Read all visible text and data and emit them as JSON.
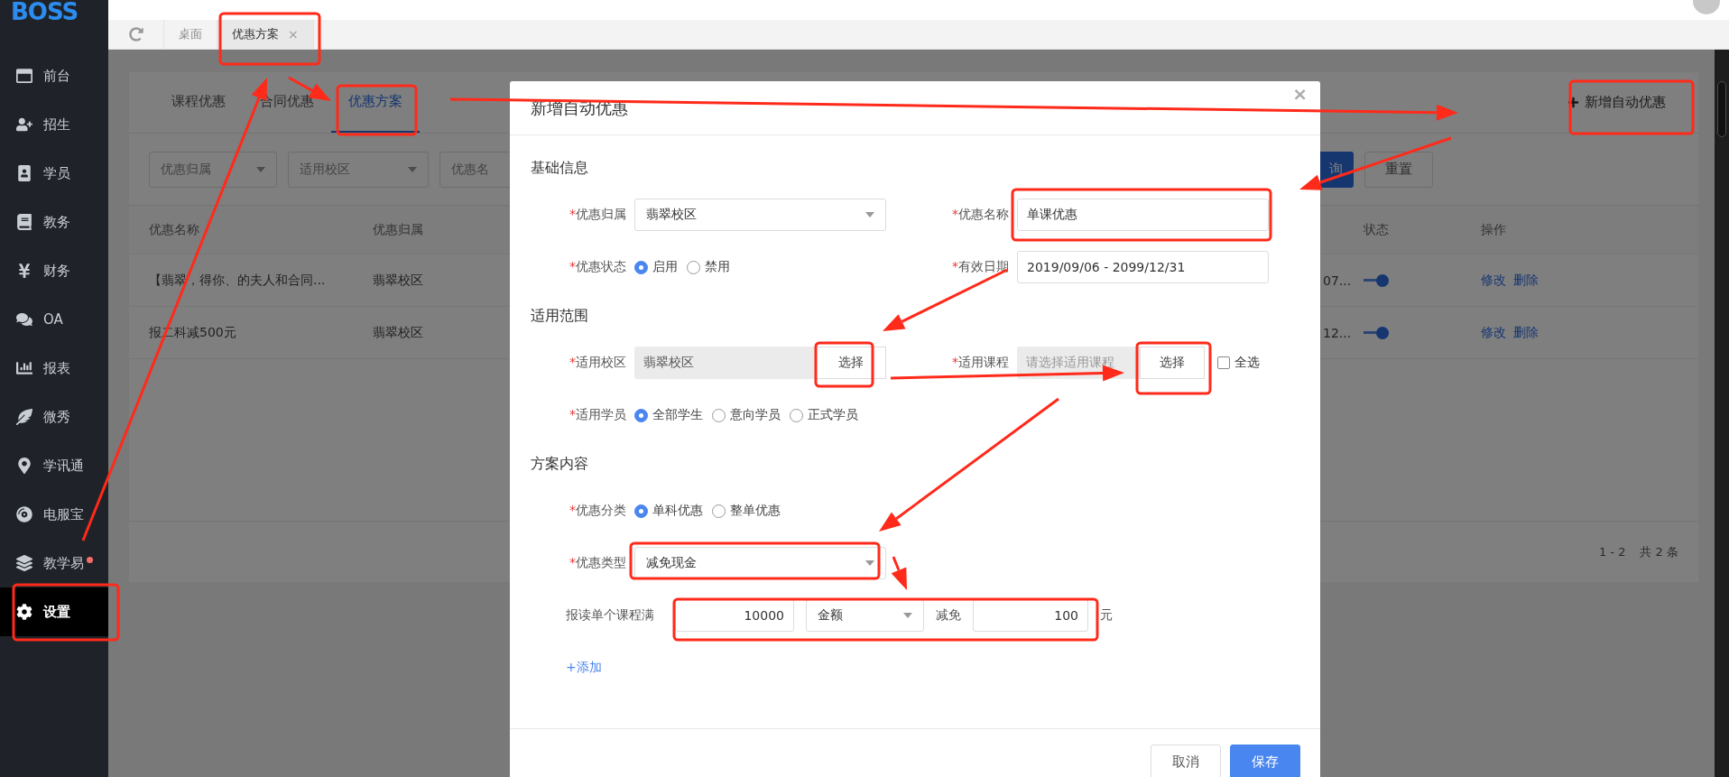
{
  "header": {
    "logo": "BOSS"
  },
  "tab_bar": {
    "tabs": [
      {
        "label": "桌面",
        "selected": false
      },
      {
        "label": "优惠方案",
        "selected": true,
        "close": "×"
      }
    ]
  },
  "sidebar": {
    "items": [
      {
        "label": "前台",
        "selected": false,
        "dot": false
      },
      {
        "label": "招生",
        "selected": false,
        "dot": false
      },
      {
        "label": "学员",
        "selected": false,
        "dot": false
      },
      {
        "label": "教务",
        "selected": false,
        "dot": false
      },
      {
        "label": "财务",
        "selected": false,
        "dot": false
      },
      {
        "label": "OA",
        "selected": false,
        "dot": false
      },
      {
        "label": "报表",
        "selected": false,
        "dot": false
      },
      {
        "label": "微秀",
        "selected": false,
        "dot": false
      },
      {
        "label": "学讯通",
        "selected": false,
        "dot": false
      },
      {
        "label": "电服宝",
        "selected": false,
        "dot": false
      },
      {
        "label": "教学易",
        "selected": false,
        "dot": true
      },
      {
        "label": "设置",
        "selected": true,
        "dot": false
      }
    ]
  },
  "page": {
    "tabs": [
      {
        "label": "课程优惠",
        "selected": false
      },
      {
        "label": "合同优惠",
        "selected": false
      },
      {
        "label": "优惠方案",
        "selected": true
      }
    ],
    "add_button": "新增自动优惠",
    "filters": [
      {
        "kind": "select",
        "placeholder": "优惠归属"
      },
      {
        "kind": "select",
        "placeholder": "适用校区"
      },
      {
        "kind": "input",
        "placeholder": "优惠名"
      }
    ],
    "query_button": "询",
    "reset_button": "重置",
    "table": {
      "columns": [
        "优惠名称",
        "优惠归属",
        "状态",
        "操作"
      ],
      "rows": [
        {
          "name": "【翡翠，得你、的夫人和合同...",
          "owner": "翡翠校区",
          "column_3": "07...",
          "on": true,
          "actions": [
            "修改",
            "删除"
          ]
        },
        {
          "name": "报二科减500元",
          "owner": "翡翠校区",
          "column_3": "12...",
          "on": true,
          "actions": [
            "修改",
            "删除"
          ]
        }
      ]
    },
    "pagination": {
      "range": "1 - 2",
      "total": "共 2 条"
    }
  },
  "modal": {
    "title": "新增自动优惠",
    "close": "×",
    "required_mark": "*",
    "sections": [
      {
        "title": "基础信息",
        "rows": [
          [
            {
              "kind": "select",
              "label": "优惠归属",
              "required": true,
              "value": "翡翠校区"
            },
            {
              "kind": "input",
              "label": "优惠名称",
              "required": true,
              "value": "单课优惠"
            }
          ],
          [
            {
              "kind": "radio",
              "label": "优惠状态",
              "required": true,
              "options": [
                {
                  "label": "启用",
                  "selected": true
                },
                {
                  "label": "禁用",
                  "selected": false
                }
              ]
            },
            {
              "kind": "input",
              "label": "有效日期",
              "required": true,
              "value": "2019/09/06 - 2099/12/31"
            }
          ]
        ]
      },
      {
        "title": "适用范围",
        "rows": [
          [
            {
              "kind": "picker",
              "label": "适用校区",
              "required": true,
              "value": "翡翠校区",
              "button": "选择"
            },
            {
              "kind": "picker",
              "label": "适用课程",
              "required": true,
              "placeholder": "请选择适用课程",
              "button": "选择",
              "checkbox": {
                "label": "全选",
                "checked": false
              }
            }
          ],
          [
            {
              "kind": "radio",
              "label": "适用学员",
              "required": true,
              "options": [
                {
                  "label": "全部学生",
                  "selected": true
                },
                {
                  "label": "意向学员",
                  "selected": false
                },
                {
                  "label": "正式学员",
                  "selected": false
                }
              ]
            }
          ]
        ]
      },
      {
        "title": "方案内容",
        "rows": [
          [
            {
              "kind": "radio",
              "label": "优惠分类",
              "required": true,
              "options": [
                {
                  "label": "单科优惠",
                  "selected": true
                },
                {
                  "label": "整单优惠",
                  "selected": false
                }
              ]
            }
          ],
          [
            {
              "kind": "select",
              "label": "优惠类型",
              "required": true,
              "value": "减免现金"
            }
          ],
          [
            {
              "kind": "rule",
              "label": "报读单个课程满",
              "threshold": "10000",
              "unit_select": "金额",
              "discount_label": "减免",
              "discount": "100",
              "unit": "元"
            }
          ],
          [
            {
              "kind": "link",
              "label": "+添加"
            }
          ]
        ]
      }
    ],
    "buttons": [
      {
        "label": "取消",
        "kind": "secondary"
      },
      {
        "label": "保存",
        "kind": "primary"
      }
    ]
  }
}
